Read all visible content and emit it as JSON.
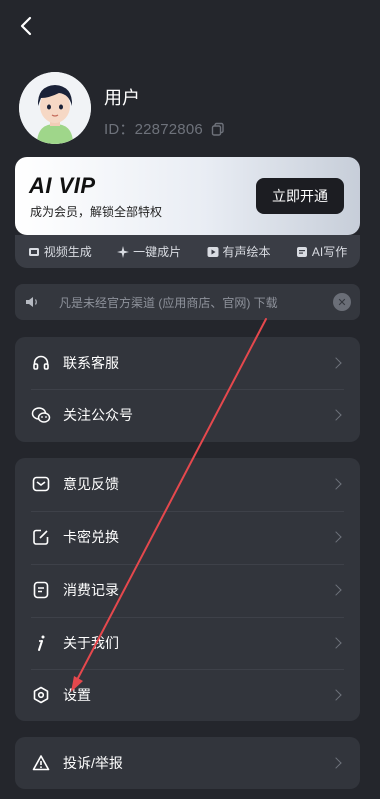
{
  "header": {
    "back_icon": "back-arrow-icon"
  },
  "profile": {
    "name": "用户",
    "id_text": "ID：22872806",
    "copy_icon": "copy-icon"
  },
  "vip": {
    "logo": "AI VIP",
    "subtitle": "成为会员，解锁全部特权",
    "button": "立即开通"
  },
  "features": [
    {
      "label": "视频生成",
      "icon": "video-icon"
    },
    {
      "label": "一键成片",
      "icon": "sparkle-icon"
    },
    {
      "label": "有声绘本",
      "icon": "play-icon"
    },
    {
      "label": "AI写作",
      "icon": "document-icon"
    }
  ],
  "notice": {
    "text": "凡是未经官方渠道 (应用商店、官网) 下载",
    "icon": "speaker-icon"
  },
  "group1": [
    {
      "label": "联系客服",
      "icon": "headset-icon"
    },
    {
      "label": "关注公众号",
      "icon": "wechat-icon"
    }
  ],
  "group2": [
    {
      "label": "意见反馈",
      "icon": "feedback-icon"
    },
    {
      "label": "卡密兑换",
      "icon": "edit-icon"
    },
    {
      "label": "消费记录",
      "icon": "record-icon"
    },
    {
      "label": "关于我们",
      "icon": "info-icon"
    },
    {
      "label": "设置",
      "icon": "settings-icon"
    }
  ],
  "group3": [
    {
      "label": "投诉/举报",
      "icon": "warning-icon"
    }
  ],
  "colors": {
    "background": "#24262c",
    "card": "#32353c",
    "annotation_arrow": "#e5484d"
  }
}
